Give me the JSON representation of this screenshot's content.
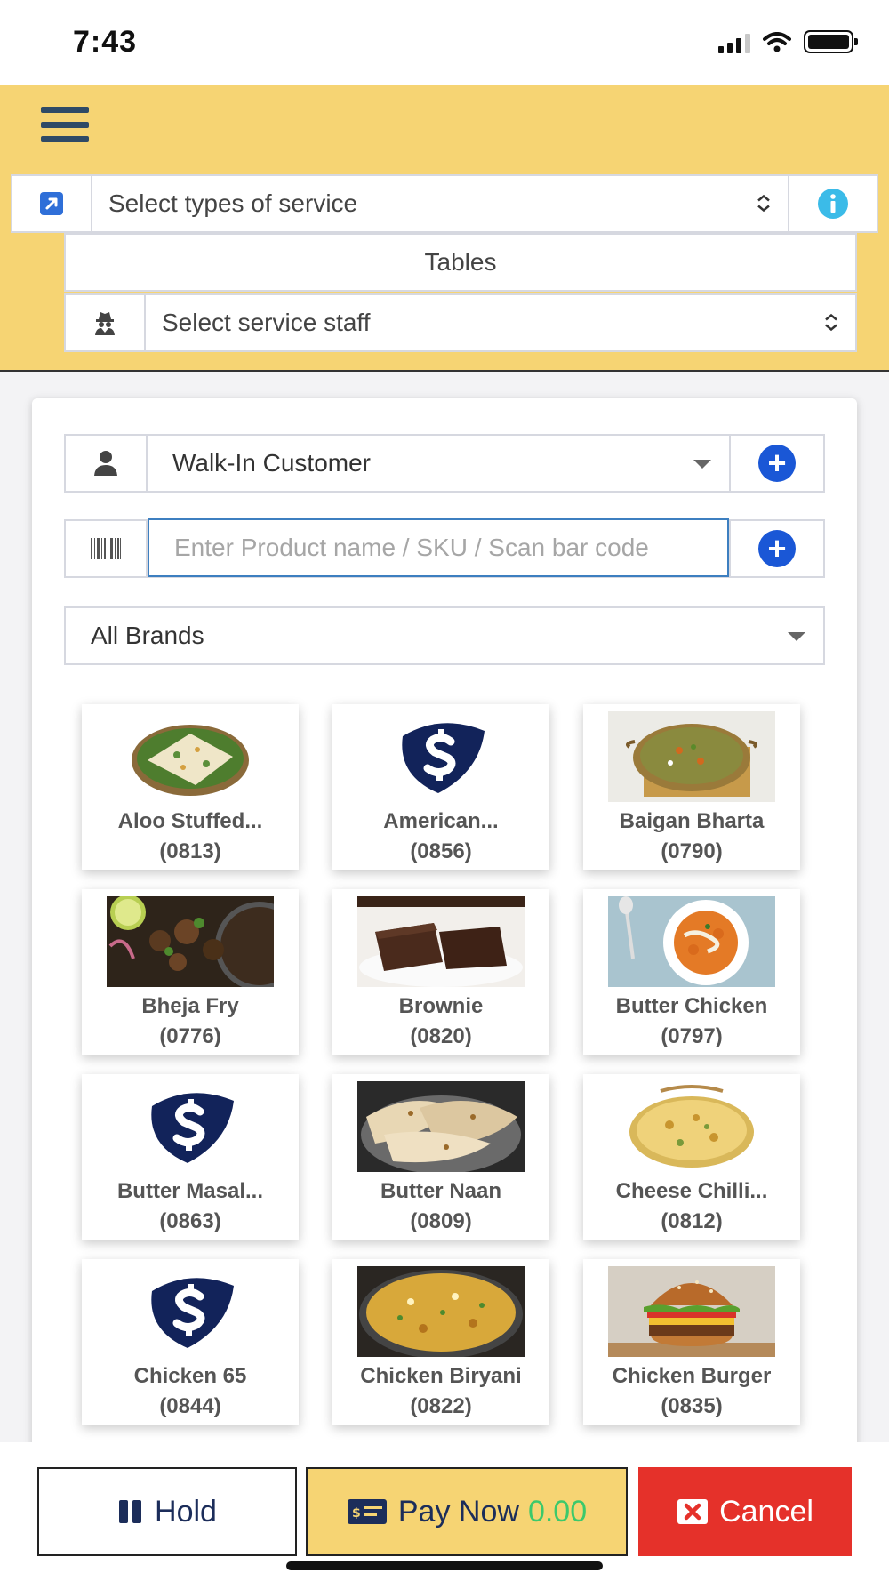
{
  "status_bar": {
    "time": "7:43"
  },
  "header": {
    "service_type_placeholder": "Select types of service",
    "tables_label": "Tables",
    "service_staff_placeholder": "Select service staff"
  },
  "pos": {
    "customer_value": "Walk-In Customer",
    "product_search_placeholder": "Enter Product name / SKU / Scan bar code",
    "brand_filter_value": "All Brands"
  },
  "products": [
    {
      "name": "Aloo Stuffed...",
      "sku": "(0813)",
      "image": "aloo-paratha-photo"
    },
    {
      "name": "American...",
      "sku": "(0856)",
      "image": "placeholder-logo"
    },
    {
      "name": "Baigan Bharta",
      "sku": "(0790)",
      "image": "baigan-bharta-photo"
    },
    {
      "name": "Bheja Fry",
      "sku": "(0776)",
      "image": "bheja-fry-photo"
    },
    {
      "name": "Brownie",
      "sku": "(0820)",
      "image": "brownie-photo"
    },
    {
      "name": "Butter Chicken",
      "sku": "(0797)",
      "image": "butter-chicken-photo"
    },
    {
      "name": "Butter Masal...",
      "sku": "(0863)",
      "image": "placeholder-logo"
    },
    {
      "name": "Butter Naan",
      "sku": "(0809)",
      "image": "butter-naan-photo"
    },
    {
      "name": "Cheese Chilli...",
      "sku": "(0812)",
      "image": "cheese-naan-photo"
    },
    {
      "name": "Chicken 65",
      "sku": "(0844)",
      "image": "placeholder-logo"
    },
    {
      "name": "Chicken Biryani",
      "sku": "(0822)",
      "image": "biryani-photo"
    },
    {
      "name": "Chicken Burger",
      "sku": "(0835)",
      "image": "burger-photo"
    }
  ],
  "footer": {
    "hold_label": "Hold",
    "pay_label": "Pay Now",
    "pay_amount": "0.00",
    "cancel_label": "Cancel"
  },
  "colors": {
    "header_bg": "#f6d473",
    "primary_blue": "#1a57d6",
    "cancel_red": "#e5312a",
    "amount_green": "#3cc96b",
    "info_cyan": "#3bbbe8"
  }
}
